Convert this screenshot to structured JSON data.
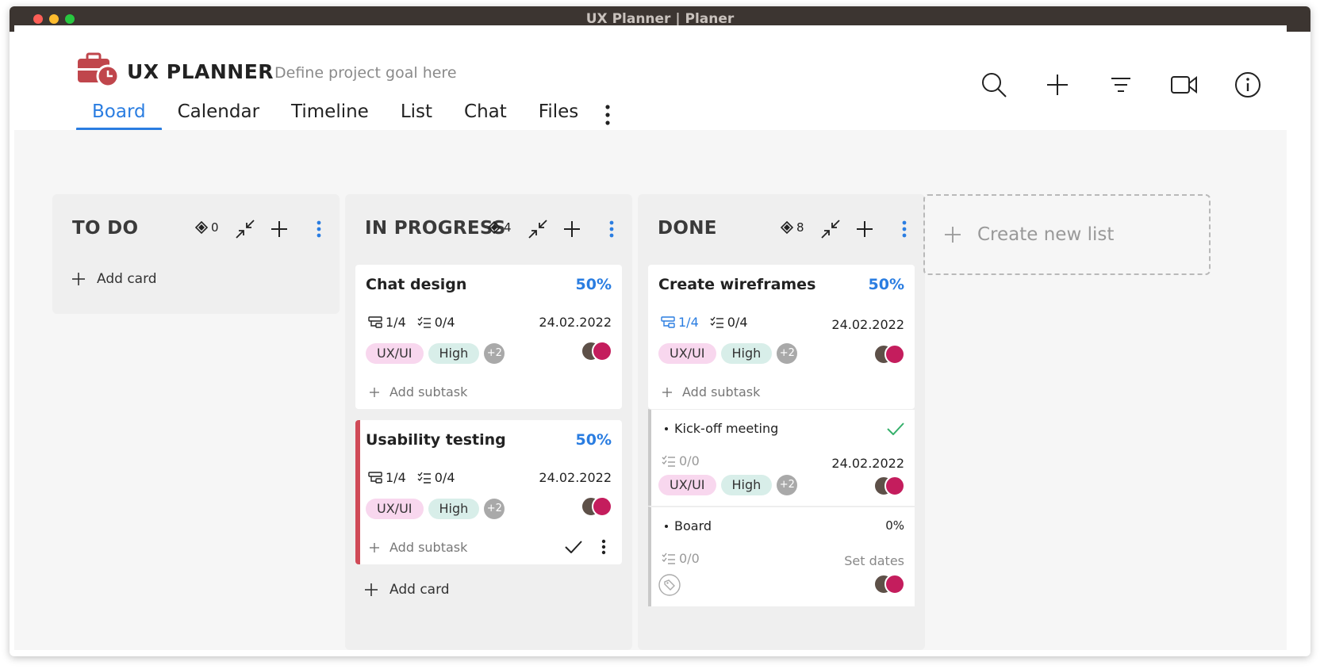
{
  "window": {
    "title": "UX Planner | Planer"
  },
  "header": {
    "app_name": "UX PLANNER",
    "project_goal_placeholder": "Define project goal here",
    "tabs": [
      {
        "label": "Board",
        "active": true
      },
      {
        "label": "Calendar"
      },
      {
        "label": "Timeline"
      },
      {
        "label": "List"
      },
      {
        "label": "Chat"
      },
      {
        "label": "Files"
      }
    ],
    "toolbar": [
      "search-icon",
      "plus-icon",
      "filter-icon",
      "video-icon",
      "info-icon"
    ]
  },
  "board": {
    "add_card_label": "Add card",
    "add_subtask_label": "Add subtask",
    "create_list_label": "Create new list",
    "columns": [
      {
        "title": "TO DO",
        "count": "0"
      },
      {
        "title": "IN PROGRESS",
        "count": "4",
        "cards": [
          {
            "title": "Chat design",
            "percent": "50%",
            "subtasks": "1/4",
            "checklist": "0/4",
            "date": "24.02.2022",
            "tags": [
              "UX/UI",
              "High"
            ],
            "more_tags": "+2"
          },
          {
            "title": "Usability testing",
            "percent": "50%",
            "subtasks": "1/4",
            "checklist": "0/4",
            "date": "24.02.2022",
            "tags": [
              "UX/UI",
              "High"
            ],
            "more_tags": "+2",
            "flag_color": "#d04a57"
          }
        ]
      },
      {
        "title": "DONE",
        "count": "8",
        "cards": [
          {
            "title": "Create wireframes",
            "percent": "50%",
            "subtasks": "1/4",
            "checklist": "0/4",
            "date": "24.02.2022",
            "tags": [
              "UX/UI",
              "High"
            ],
            "more_tags": "+2"
          }
        ],
        "subtasks": [
          {
            "title": "Kick-off meeting",
            "done": true,
            "checklist": "0/0",
            "date": "24.02.2022",
            "tags": [
              "UX/UI",
              "High"
            ],
            "more_tags": "+2"
          },
          {
            "title": "Board",
            "percent": "0%",
            "checklist": "0/0",
            "date": "Set dates"
          }
        ]
      }
    ]
  },
  "colors": {
    "accent": "#2a7de1",
    "flag": "#d04a57",
    "brand": "#c0464c"
  }
}
